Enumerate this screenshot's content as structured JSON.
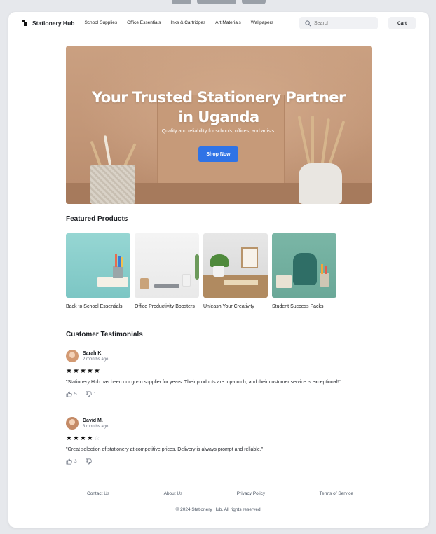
{
  "brand": {
    "name": "Stationery Hub"
  },
  "nav": {
    "links": [
      "School Supplies",
      "Office Essentials",
      "Inks & Cartridges",
      "Art Materials",
      "Wallpapers"
    ],
    "search_placeholder": "Search",
    "cart_label": "Cart"
  },
  "hero": {
    "title": "Your Trusted Stationery Partner in Uganda",
    "subtitle": "Quality and reliability for schools, offices, and artists.",
    "cta_label": "Shop Now"
  },
  "featured": {
    "heading": "Featured Products",
    "items": [
      {
        "name": "Back to School Essentials"
      },
      {
        "name": "Office Productivity Boosters"
      },
      {
        "name": "Unleash Your Creativity"
      },
      {
        "name": "Student Success Packs"
      }
    ]
  },
  "testimonials": {
    "heading": "Customer Testimonials",
    "reviews": [
      {
        "name": "Sarah K.",
        "time": "2 months ago",
        "rating": 5,
        "text": "\"Stationery Hub has been our go-to supplier for years. Their products are top-notch, and their customer service is exceptional!\"",
        "likes": "5",
        "dislikes": "1"
      },
      {
        "name": "David M.",
        "time": "3 months ago",
        "rating": 4,
        "text": "\"Great selection of stationery at competitive prices. Delivery is always prompt and reliable.\"",
        "likes": "3",
        "dislikes": ""
      }
    ]
  },
  "footer": {
    "links": [
      "Contact Us",
      "About Us",
      "Privacy Policy",
      "Terms of Service"
    ],
    "copyright": "© 2024 Stationery Hub. All rights reserved."
  },
  "colors": {
    "accent": "#2f73e6",
    "page_bg": "#e6e8ec"
  }
}
